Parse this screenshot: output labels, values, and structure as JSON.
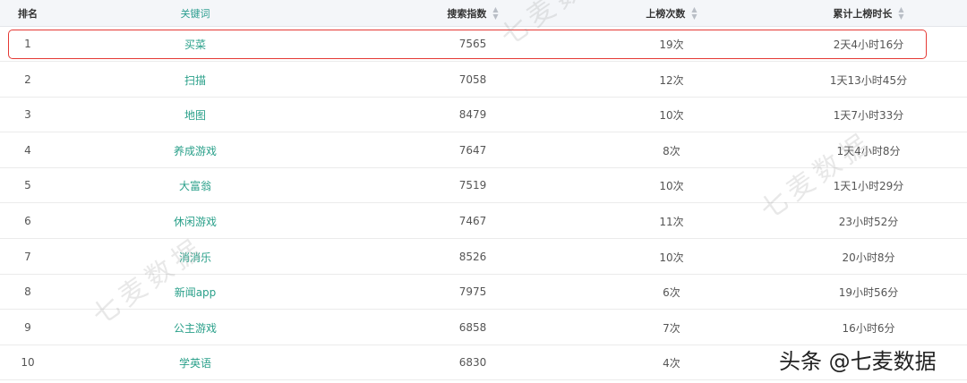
{
  "header": {
    "rank": "排名",
    "keyword": "关键词",
    "search_index": "搜索指数",
    "times": "上榜次数",
    "duration": "累计上榜时长",
    "sort_icon": "sort-icon"
  },
  "rows": [
    {
      "rank": "1",
      "keyword": "买菜",
      "search_index": "7565",
      "times": "19次",
      "duration": "2天4小时16分"
    },
    {
      "rank": "2",
      "keyword": "扫描",
      "search_index": "7058",
      "times": "12次",
      "duration": "1天13小时45分"
    },
    {
      "rank": "3",
      "keyword": "地图",
      "search_index": "8479",
      "times": "10次",
      "duration": "1天7小时33分"
    },
    {
      "rank": "4",
      "keyword": "养成游戏",
      "search_index": "7647",
      "times": "8次",
      "duration": "1天4小时8分"
    },
    {
      "rank": "5",
      "keyword": "大富翁",
      "search_index": "7519",
      "times": "10次",
      "duration": "1天1小时29分"
    },
    {
      "rank": "6",
      "keyword": "休闲游戏",
      "search_index": "7467",
      "times": "11次",
      "duration": "23小时52分"
    },
    {
      "rank": "7",
      "keyword": "消消乐",
      "search_index": "8526",
      "times": "10次",
      "duration": "20小时8分"
    },
    {
      "rank": "8",
      "keyword": "新闻app",
      "search_index": "7975",
      "times": "6次",
      "duration": "19小时56分"
    },
    {
      "rank": "9",
      "keyword": "公主游戏",
      "search_index": "6858",
      "times": "7次",
      "duration": "16小时6分"
    },
    {
      "rank": "10",
      "keyword": "学英语",
      "search_index": "6830",
      "times": "4次",
      "duration": ""
    }
  ],
  "watermark": "七麦数据",
  "credit": "头条 @七麦数据",
  "colors": {
    "keyword_link": "#2aa08a",
    "highlight_border": "#e53935",
    "header_bg": "#f4f6f9"
  }
}
